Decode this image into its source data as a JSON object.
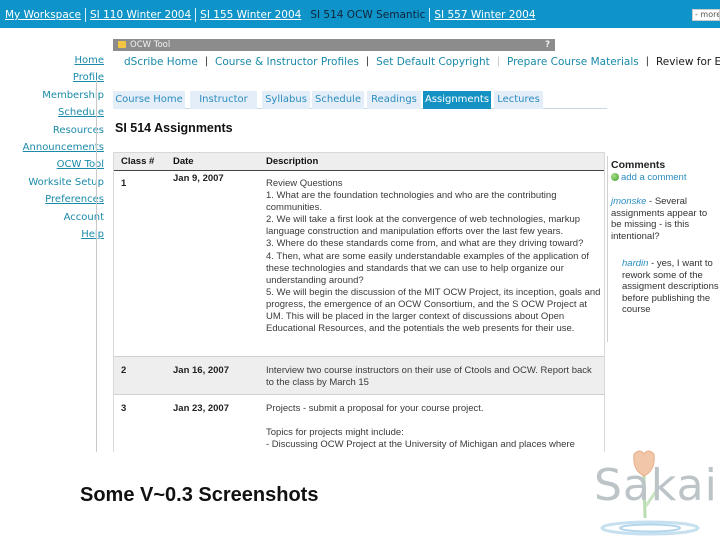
{
  "site_tabs": [
    {
      "label": "My Workspace",
      "current": false
    },
    {
      "label": "SI 110 Winter 2004",
      "current": false
    },
    {
      "label": "SI 155 Winter 2004",
      "current": false
    },
    {
      "label": "SI 514 OCW Semantic",
      "current": true
    },
    {
      "label": "SI 557 Winter 2004",
      "current": false
    }
  ],
  "more_select": "- more -",
  "left_nav": [
    {
      "label": "Home",
      "link": true
    },
    {
      "label": "Profile",
      "link": true
    },
    {
      "label": "Membership",
      "link": false
    },
    {
      "label": "Schedule",
      "link": true
    },
    {
      "label": "Resources",
      "link": false
    },
    {
      "label": "Announcements",
      "link": true
    },
    {
      "label": "OCW Tool",
      "link": true
    },
    {
      "label": "Worksite Setup",
      "link": false
    },
    {
      "label": "Preferences",
      "link": true
    },
    {
      "label": "Account",
      "link": false
    },
    {
      "label": "Help",
      "link": true
    }
  ],
  "tool": {
    "title": "OCW Tool",
    "help": "?"
  },
  "dscribe_menu": [
    {
      "label": "dScribe Home",
      "current": false
    },
    {
      "label": "Course & Instructor Profiles",
      "current": false
    },
    {
      "label": "Set Default Copyright",
      "current": false
    },
    {
      "label": "Prepare Course Materials",
      "current": false
    },
    {
      "label": "Review for Export",
      "current": true
    }
  ],
  "course_tabs": [
    {
      "label": "Course Home",
      "active": false
    },
    {
      "label": "Instructor",
      "active": false
    },
    {
      "label": "Syllabus",
      "active": false
    },
    {
      "label": "Schedule",
      "active": false
    },
    {
      "label": "Readings",
      "active": false
    },
    {
      "label": "Assignments",
      "active": true
    },
    {
      "label": "Lectures",
      "active": false
    }
  ],
  "page_title": "SI 514 Assignments",
  "table": {
    "headers": [
      "Class #",
      "Date",
      "Description"
    ],
    "rows": [
      {
        "num": "1",
        "date": "Jan 9, 2007",
        "description": [
          "Review Questions",
          "1. What are the foundation technologies and who are the contributing communities.",
          "2. We will take a first look at the convergence of web technologies, markup language construction and manipulation efforts over the last few years.",
          "3. Where do these standards come from, and what are they driving toward?",
          "4. Then, what are some easily understandable examples of the application of these technologies and standards that we can use to help organize our understanding around?",
          "5. We will begin the discussion of the MIT OCW Project, its inception, goals and progress, the emergence of an OCW Consortium, and the S OCW Project at UM. This will be placed in the larger context of discussions about Open Educational Resources, and the potentials the web presents for their use."
        ]
      },
      {
        "num": "2",
        "date": "Jan 16, 2007",
        "description": [
          "Interview two course instructors on their use of Ctools and OCW. Report back to the class by March 15"
        ]
      },
      {
        "num": "3",
        "date": "Jan 23, 2007",
        "description": [
          "Projects - submit a proposal for your course project.",
          "",
          "Topics for projects might include:",
          "- Discussing OCW Project at the University of Michigan and places where"
        ]
      }
    ]
  },
  "comments": {
    "title": "Comments",
    "add_label": "add a comment",
    "items": [
      {
        "author": "jmonske",
        "text": " - Several assignments appear to be missing - is this intentional?"
      },
      {
        "author": "hardin",
        "text": " - yes, I want to rework some of the assigment descriptions before publishing the course"
      }
    ]
  },
  "caption": "Some V~0.3 Screenshots",
  "logo": {
    "text": "Sakai"
  },
  "colors": {
    "brand_blue": "#0e94c8",
    "link_teal": "#1a8aa8",
    "active_tab": "#1592c4"
  }
}
